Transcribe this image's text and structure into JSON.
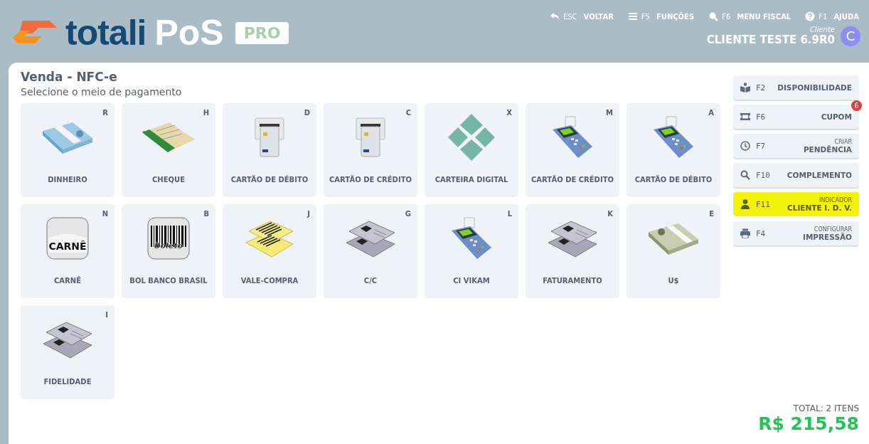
{
  "logo": {
    "brand": "totali",
    "product": "PoS",
    "edition": "PRO"
  },
  "nav": [
    {
      "kind": "back",
      "key": "ESC",
      "label": "VOLTAR"
    },
    {
      "kind": "menu",
      "key": "F5",
      "label": "FUNÇÕES"
    },
    {
      "kind": "search",
      "key": "F6",
      "label": "MENU FISCAL"
    },
    {
      "kind": "help",
      "key": "F1",
      "label": "AJUDA"
    }
  ],
  "client": {
    "caption": "Cliente",
    "name": "CLIENTE TESTE 6.9R0",
    "avatar": "C"
  },
  "title": "Venda - NFC-e",
  "subtitle": "Selecione o meio de pagamento",
  "payment_methods": [
    {
      "kind": "cash",
      "key": "R",
      "label": "DINHEIRO"
    },
    {
      "kind": "cheque",
      "key": "H",
      "label": "CHEQUE"
    },
    {
      "kind": "card-slot",
      "key": "D",
      "label": "CARTÃO DE DÉBITO"
    },
    {
      "kind": "card-slot",
      "key": "C",
      "label": "CARTÃO DE CRÉDITO"
    },
    {
      "kind": "pix",
      "key": "X",
      "label": "CARTEIRA DIGITAL"
    },
    {
      "kind": "terminal",
      "key": "M",
      "label": "CARTÃO DE CRÉDITO"
    },
    {
      "kind": "terminal",
      "key": "A",
      "label": "CARTÃO DE DÉBITO"
    },
    {
      "kind": "carne",
      "key": "N",
      "label": "CARNÊ",
      "icon_text": "CARNÊ"
    },
    {
      "kind": "boleto",
      "key": "B",
      "label": "BOL BANCO BRASIL",
      "icon_text": "Boleto"
    },
    {
      "kind": "voucher",
      "key": "J",
      "label": "VALE-COMPRA"
    },
    {
      "kind": "id-cards",
      "key": "G",
      "label": "C/C"
    },
    {
      "kind": "terminal",
      "key": "L",
      "label": "CI VIKAM"
    },
    {
      "kind": "id-cards",
      "key": "K",
      "label": "FATURAMENTO"
    },
    {
      "kind": "dollars",
      "key": "E",
      "label": "U$"
    },
    {
      "kind": "id-cards",
      "key": "I",
      "label": "FIDELIDADE"
    }
  ],
  "actions": [
    {
      "kind": "book",
      "key": "F2",
      "label": "DISPONIBILIDADE",
      "highlighted": false
    },
    {
      "kind": "ticket",
      "key": "F6",
      "label": "CUPOM",
      "badge": "6",
      "highlighted": false
    },
    {
      "kind": "clock",
      "key": "F7",
      "caption": "CRIAR",
      "label": "PENDÊNCIA",
      "highlighted": false
    },
    {
      "kind": "search",
      "key": "F10",
      "label": "COMPLEMENTO",
      "highlighted": false
    },
    {
      "kind": "person",
      "key": "F11",
      "caption": "INDICADOR",
      "label": "CLIENTE I. D. V.",
      "highlighted": true
    },
    {
      "kind": "printer",
      "key": "F4",
      "caption": "CONFIGURAR",
      "label": "IMPRESSÃO",
      "highlighted": false
    }
  ],
  "total": {
    "label": "TOTAL: 2 ITENS",
    "amount": "R$ 215,58"
  }
}
